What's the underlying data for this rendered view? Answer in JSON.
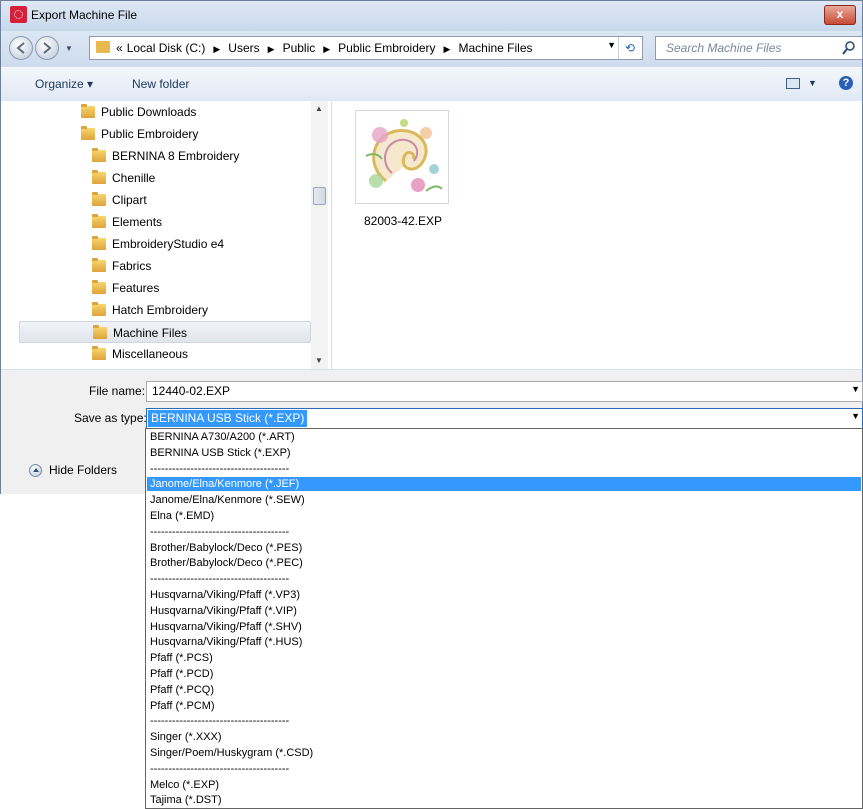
{
  "window": {
    "title": "Export Machine File",
    "close_label": "x"
  },
  "address": {
    "breadcrumbs": [
      "«",
      "Local Disk (C:)",
      "Users",
      "Public",
      "Public Embroidery",
      "Machine Files"
    ],
    "search_placeholder": "Search Machine Files"
  },
  "toolbar": {
    "organize_label": "Organize ▾",
    "new_folder_label": "New folder"
  },
  "nav_tree": [
    {
      "label": "Public Downloads",
      "level": 1
    },
    {
      "label": "Public Embroidery",
      "level": 1
    },
    {
      "label": "BERNINA 8 Embroidery",
      "level": 2
    },
    {
      "label": "Chenille",
      "level": 2
    },
    {
      "label": "Clipart",
      "level": 2
    },
    {
      "label": "Elements",
      "level": 2
    },
    {
      "label": "EmbroideryStudio e4",
      "level": 2
    },
    {
      "label": "Fabrics",
      "level": 2
    },
    {
      "label": "Features",
      "level": 2
    },
    {
      "label": "Hatch Embroidery",
      "level": 2
    },
    {
      "label": "Machine Files",
      "level": 2,
      "selected": true
    },
    {
      "label": "Miscellaneous",
      "level": 2
    }
  ],
  "files": [
    {
      "name": "82003-42.EXP"
    }
  ],
  "form": {
    "file_name_label": "File name:",
    "file_name_value": "12440-02.EXP",
    "save_type_label": "Save as type:",
    "save_type_value": "BERNINA USB Stick (*.EXP)",
    "hide_folders_label": "Hide Folders"
  },
  "type_options": [
    "BERNINA A730/A200 (*.ART)",
    "BERNINA USB Stick (*.EXP)",
    "--------------------------------------",
    "Janome/Elna/Kenmore (*.JEF)",
    "Janome/Elna/Kenmore (*.SEW)",
    "Elna (*.EMD)",
    "--------------------------------------",
    "Brother/Babylock/Deco (*.PES)",
    "Brother/Babylock/Deco (*.PEC)",
    "--------------------------------------",
    "Husqvarna/Viking/Pfaff (*.VP3)",
    "Husqvarna/Viking/Pfaff (*.VIP)",
    "Husqvarna/Viking/Pfaff (*.SHV)",
    "Husqvarna/Viking/Pfaff (*.HUS)",
    "Pfaff (*.PCS)",
    "Pfaff (*.PCD)",
    "Pfaff (*.PCQ)",
    "Pfaff (*.PCM)",
    "--------------------------------------",
    "Singer (*.XXX)",
    "Singer/Poem/Huskygram (*.CSD)",
    "--------------------------------------",
    "Melco (*.EXP)",
    "Tajima (*.DST)"
  ],
  "highlighted_option": "Janome/Elna/Kenmore (*.JEF)",
  "colors": {
    "selection": "#3399ff",
    "titlebar": "#c8d8ec"
  }
}
